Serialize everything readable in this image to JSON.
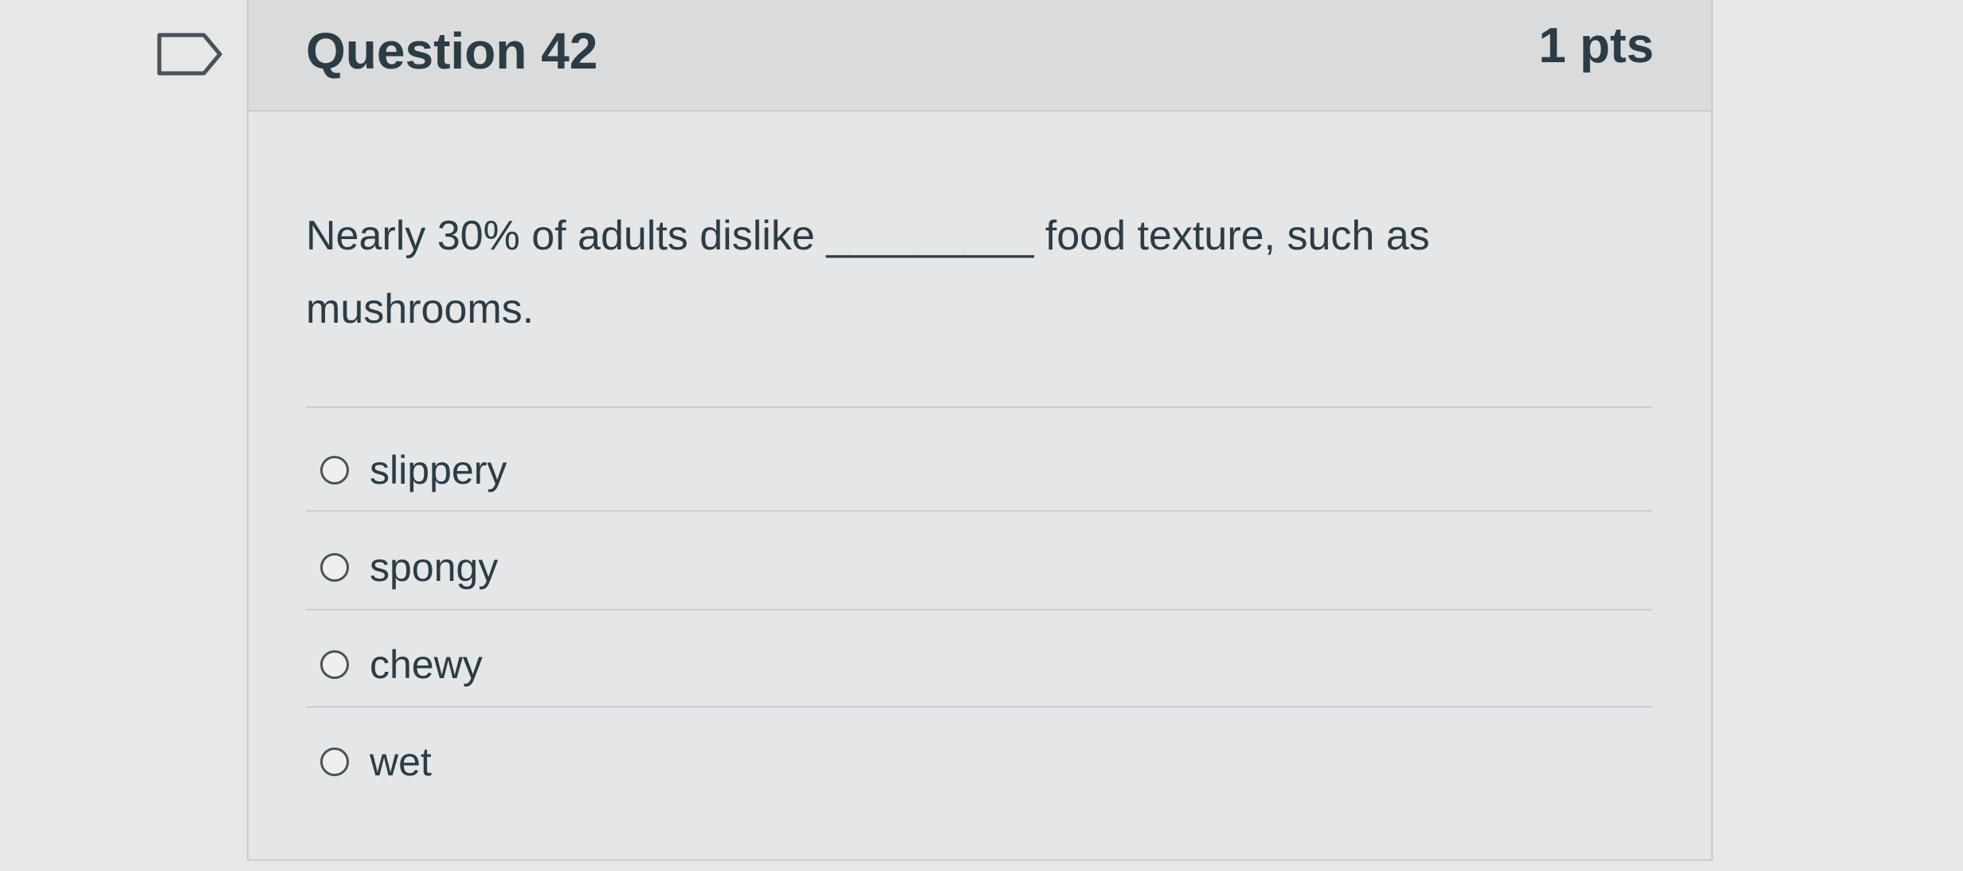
{
  "question": {
    "title": "Question 42",
    "points": "1 pts",
    "text": "Nearly 30% of adults dislike _________ food texture, such as mushrooms."
  },
  "answers": [
    {
      "label": "slippery"
    },
    {
      "label": "spongy"
    },
    {
      "label": "chewy"
    },
    {
      "label": "wet"
    }
  ],
  "icons": {
    "flag": "flag-question-icon",
    "radio": "radio-unchecked-icon"
  },
  "colors": {
    "page_background": "#e6e7e7",
    "header_background": "#d9dbdc",
    "text": "#2d3b45",
    "border": "#c7cdd1"
  }
}
